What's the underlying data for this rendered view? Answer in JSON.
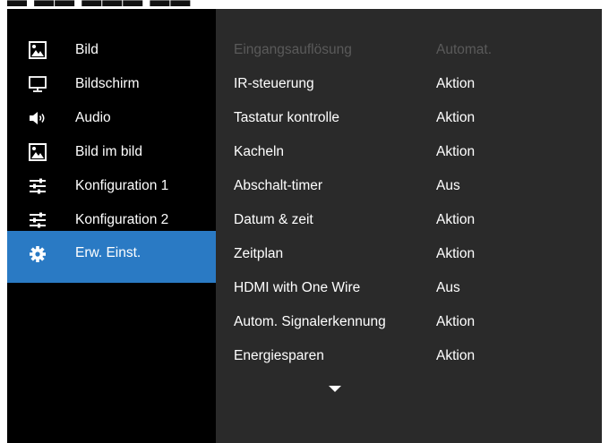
{
  "sidebar": {
    "items": [
      {
        "label": "Bild",
        "icon": "picture-icon"
      },
      {
        "label": "Bildschirm",
        "icon": "monitor-icon"
      },
      {
        "label": "Audio",
        "icon": "speaker-icon"
      },
      {
        "label": "Bild im bild",
        "icon": "picture-icon"
      },
      {
        "label": "Konfiguration 1",
        "icon": "sliders-icon"
      },
      {
        "label": "Konfiguration 2",
        "icon": "sliders-icon"
      },
      {
        "label": "Erw. Einst.",
        "icon": "gear-icon",
        "active": true
      }
    ]
  },
  "settings": {
    "rows": [
      {
        "label": "Eingangsauflösung",
        "value": "Automat.",
        "disabled": true
      },
      {
        "label": "IR-steuerung",
        "value": "Aktion"
      },
      {
        "label": "Tastatur kontrolle",
        "value": "Aktion"
      },
      {
        "label": "Kacheln",
        "value": "Aktion"
      },
      {
        "label": "Abschalt-timer",
        "value": "Aus"
      },
      {
        "label": "Datum & zeit",
        "value": "Aktion"
      },
      {
        "label": "Zeitplan",
        "value": "Aktion"
      },
      {
        "label": "HDMI with One Wire",
        "value": "Aus"
      },
      {
        "label": "Autom. Signalerkennung",
        "value": "Aktion"
      },
      {
        "label": "Energiesparen",
        "value": "Aktion"
      }
    ]
  },
  "colors": {
    "sidebar_bg": "#000000",
    "main_bg": "#2a2a2a",
    "active_bg": "#2a7ac4",
    "text": "#ffffff",
    "disabled_text": "#5a5a5a"
  },
  "scroll_icon": "chevron-down-icon"
}
